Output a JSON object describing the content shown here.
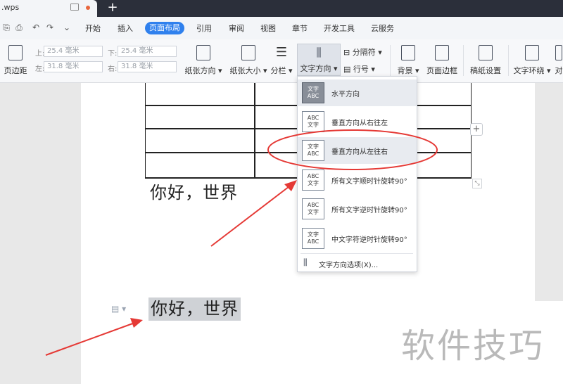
{
  "titlebar": {
    "doc_name": ".wps",
    "new_tab": "+"
  },
  "menu": {
    "tabs": [
      "开始",
      "插入",
      "页面布局",
      "引用",
      "审阅",
      "视图",
      "章节",
      "开发工具",
      "云服务"
    ],
    "active_tab": "页面布局"
  },
  "ribbon": {
    "margins": {
      "label": "页边距",
      "top_label": "上:",
      "top": "25.4 毫米",
      "bottom_label": "下:",
      "bottom": "25.4 毫米",
      "left_label": "左:",
      "left": "31.8 毫米",
      "right_label": "右:",
      "right": "31.8 毫米"
    },
    "orientation": "纸张方向",
    "size": "纸张大小",
    "columns": "分栏",
    "text_direction": "文字方向",
    "separator": "分隔符",
    "line_number": "行号",
    "background": "背景",
    "page_border": "页面边框",
    "paper_settings": "稿纸设置",
    "text_wrap": "文字环绕",
    "align": "对"
  },
  "document": {
    "table_text": "你好，世界",
    "selected_text": "你好，世界",
    "table_add": "+",
    "resize_glyph": "⤡"
  },
  "dropdown": {
    "items": [
      {
        "label": "水平方向",
        "icon": "文字\nABC"
      },
      {
        "label": "垂直方向从右往左",
        "icon": "ABC 文字"
      },
      {
        "label": "垂直方向从左往右",
        "icon": "ABC 文字"
      },
      {
        "label": "所有文字顺时针旋转90°",
        "icon": "ABC 文字"
      },
      {
        "label": "所有文字逆时针旋转90°",
        "icon": "ABC 文字"
      },
      {
        "label": "中文字符逆时针旋转90°",
        "icon": "文字\nABC"
      }
    ],
    "options": "文字方向选项(X)..."
  },
  "watermark": "软件技巧",
  "colors": {
    "accent": "#2f80ed",
    "annotation_red": "#e53935",
    "titlebar": "#2b2f3a"
  }
}
